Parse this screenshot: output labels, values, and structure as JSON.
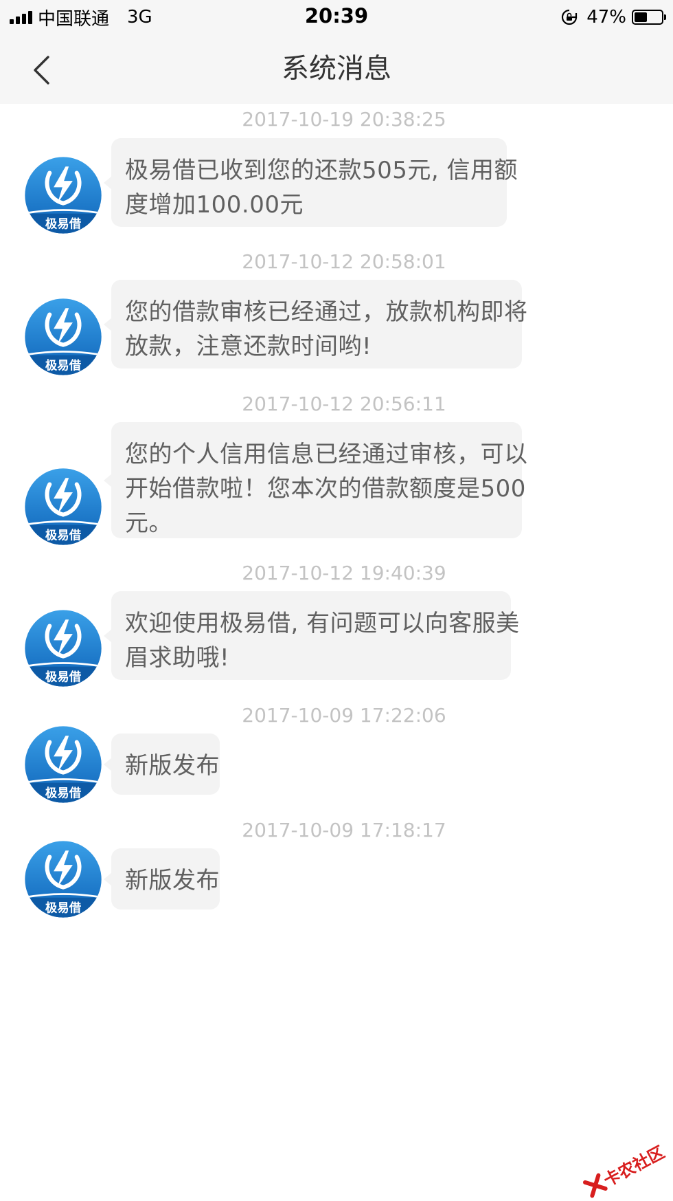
{
  "status_bar": {
    "carrier": "中国联通",
    "network": "3G",
    "time": "20:39",
    "battery_percent_label": "47%",
    "battery_level": 0.47
  },
  "nav": {
    "title": "系统消息",
    "back_icon": "chevron-left-icon"
  },
  "sender": {
    "avatar_text": "极易借",
    "avatar_icon": "lightning-bolt-icon",
    "brand_color": "#1778c8"
  },
  "messages": [
    {
      "timestamp": "2017-10-19 20:38:25",
      "lines": [
        "极易借已收到您的还款505元, 信用额",
        "度增加100.00元"
      ]
    },
    {
      "timestamp": "2017-10-12 20:58:01",
      "lines": [
        "您的借款审核已经通过，放款机构即将",
        "放款，注意还款时间哟!"
      ]
    },
    {
      "timestamp": "2017-10-12 20:56:11",
      "lines": [
        "您的个人信用信息已经通过审核，可以",
        "开始借款啦！您本次的借款额度是500",
        "元。"
      ]
    },
    {
      "timestamp": "2017-10-12 19:40:39",
      "lines": [
        "欢迎使用极易借, 有问题可以向客服美",
        "眉求助哦!"
      ]
    },
    {
      "timestamp": "2017-10-09 17:22:06",
      "lines": [
        "新版发布"
      ]
    },
    {
      "timestamp": "2017-10-09 17:18:17",
      "lines": [
        "新版发布"
      ]
    }
  ],
  "watermark": {
    "text": "卡农社区"
  },
  "colors": {
    "page_bg": "#ffffff",
    "bar_bg": "#f6f6f6",
    "bubble_bg": "#f3f3f3",
    "timestamp_text": "#c3c3c3",
    "message_text": "#606060"
  }
}
